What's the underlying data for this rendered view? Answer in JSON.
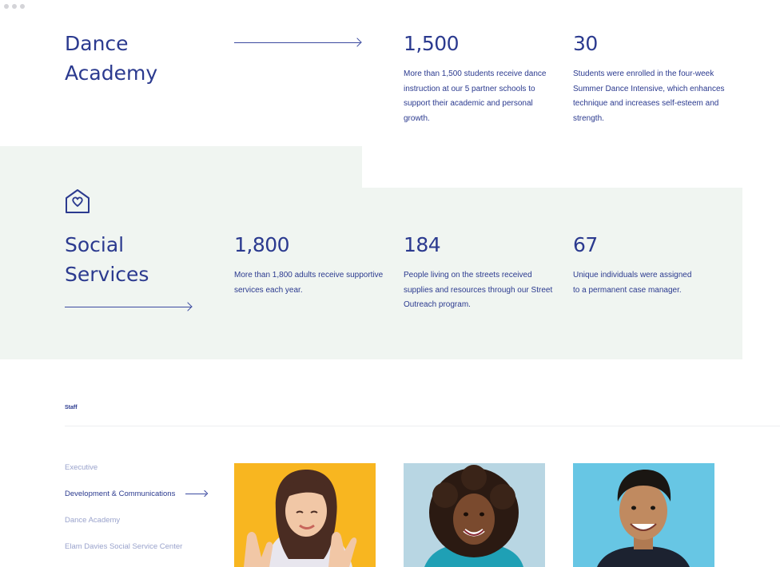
{
  "dance": {
    "title_line1": "Dance",
    "title_line2": "Academy",
    "stats": [
      {
        "number": "1,500",
        "text_lines": [
          "More than 1,500 students receive dance",
          "instruction at our 5 partner schools to",
          "support their academic and personal",
          "growth."
        ]
      },
      {
        "number": "30",
        "text_lines": [
          "Students were enrolled in the four-week",
          "Summer Dance Intensive, which enhances",
          "technique and increases self-esteem and",
          "strength."
        ]
      }
    ]
  },
  "social": {
    "icon": "house-heart-icon",
    "title_line1": "Social",
    "title_line2": "Services",
    "stats": [
      {
        "number": "1,800",
        "text_lines": [
          "More than 1,800 adults receive supportive",
          "services each year."
        ]
      },
      {
        "number": "184",
        "text_lines": [
          "People living on the streets received",
          "supplies and resources through our Street",
          "Outreach program."
        ]
      },
      {
        "number": "67",
        "text_lines": [
          "Unique individuals were assigned",
          "to a permanent case manager."
        ]
      }
    ]
  },
  "staff": {
    "label": "Staff",
    "nav": [
      {
        "label": "Executive",
        "active": false
      },
      {
        "label": "Development & Communications",
        "active": true
      },
      {
        "label": "Dance Academy",
        "active": false
      },
      {
        "label": "Elam Davies Social Service Center",
        "active": false
      }
    ],
    "photos": [
      {
        "description": "staff-photo-woman-bangs",
        "bg": "#f8b620"
      },
      {
        "description": "staff-photo-woman-curly",
        "bg": "#b8d6e3"
      },
      {
        "description": "staff-photo-man-smiling",
        "bg": "#67c6e4"
      }
    ]
  },
  "colors": {
    "primary": "#2b3a8f",
    "accent_green": "#f0f5f1",
    "muted_nav": "#9aa3cc"
  }
}
